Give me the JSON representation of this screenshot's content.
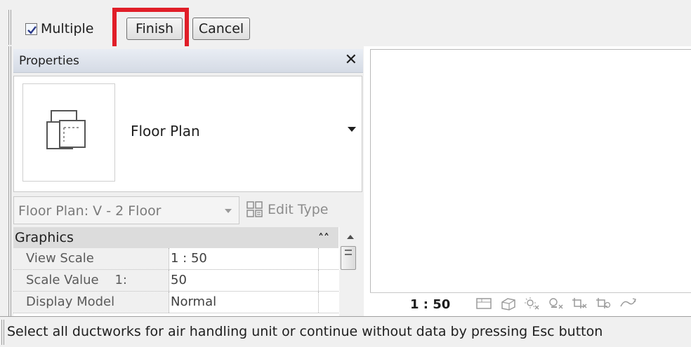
{
  "options_bar": {
    "multiple_label": "Multiple",
    "multiple_checked": true,
    "finish_label": "Finish",
    "cancel_label": "Cancel",
    "highlight_color": "#e01e28"
  },
  "properties": {
    "title": "Properties",
    "close_glyph": "✕",
    "type_name": "Floor Plan",
    "instance": "Floor Plan: V - 2 Floor",
    "edit_type_label": "Edit Type",
    "group_label": "Graphics",
    "rows": [
      {
        "key": "View Scale",
        "value": "1 : 50"
      },
      {
        "key": "Scale Value    1:",
        "value": "50"
      },
      {
        "key": "Display Model",
        "value": "Normal"
      }
    ]
  },
  "view": {
    "scale": "1 : 50",
    "control_icons": [
      "sheet-icon",
      "cube-icon",
      "sun-icon",
      "shadow-icon",
      "crop-icon",
      "crop-show-icon",
      "link-icon"
    ]
  },
  "status": {
    "message": "Select all ductworks for air handling unit or continue without data by pressing Esc button"
  }
}
